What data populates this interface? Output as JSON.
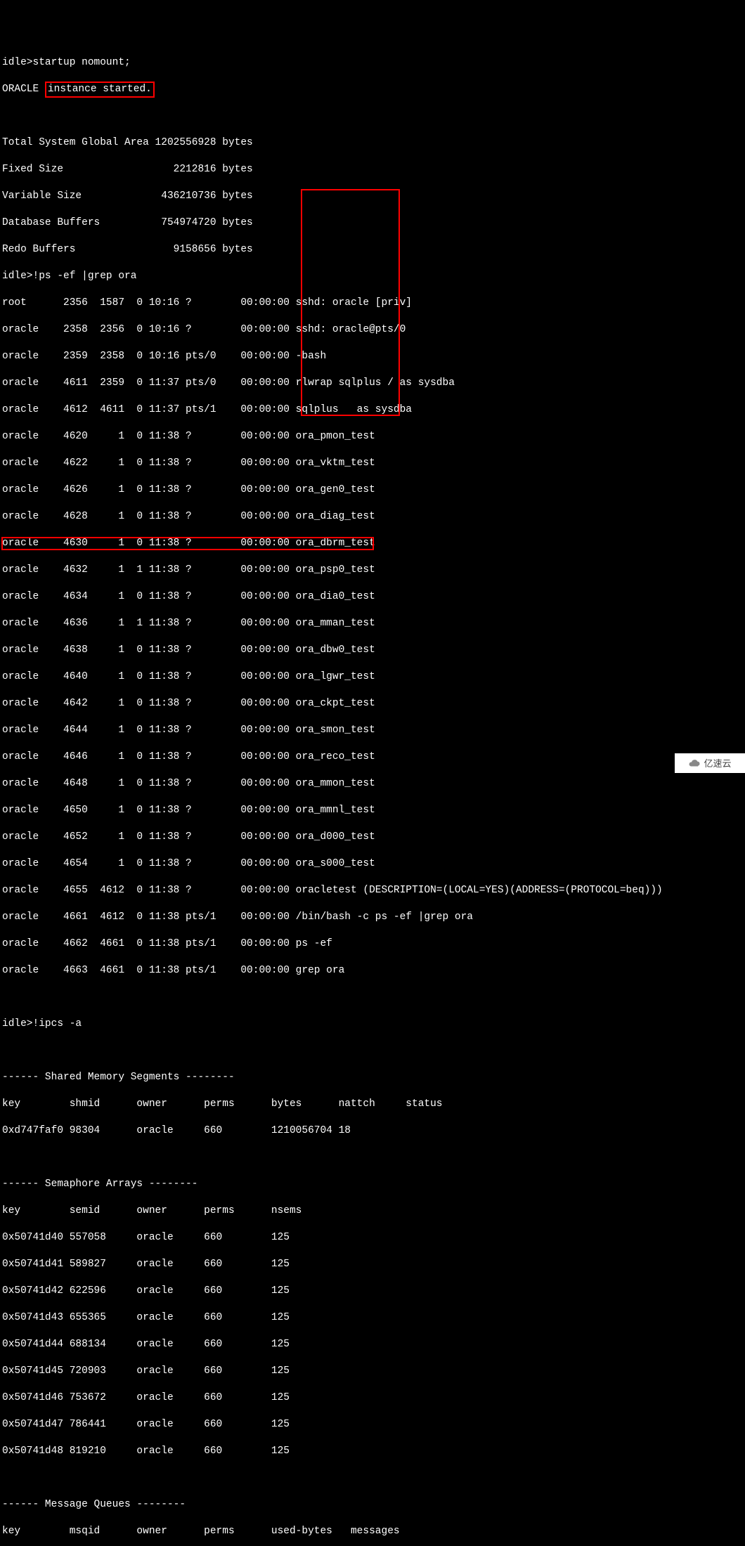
{
  "cmd1": {
    "prompt": "idle>",
    "text": "startup nomount;"
  },
  "oracle_line_prefix": "ORACLE ",
  "instance_started": "instance started.",
  "sga": {
    "total": "Total System Global Area 1202556928 bytes",
    "fixed": "Fixed Size                  2212816 bytes",
    "variable": "Variable Size             436210736 bytes",
    "dbbuf": "Database Buffers          754974720 bytes",
    "redo": "Redo Buffers                9158656 bytes"
  },
  "cmd2": {
    "prompt": "idle>",
    "text": "!ps -ef |grep ora"
  },
  "ps": [
    "root      2356  1587  0 10:16 ?        00:00:00 sshd: oracle [priv]",
    "oracle    2358  2356  0 10:16 ?        00:00:00 sshd: oracle@pts/0",
    "oracle    2359  2358  0 10:16 pts/0    00:00:00 -bash",
    "oracle    4611  2359  0 11:37 pts/0    00:00:00 rlwrap sqlplus / as sysdba",
    "oracle    4612  4611  0 11:37 pts/1    00:00:00 sqlplus   as sysdba",
    "oracle    4620     1  0 11:38 ?        00:00:00 ora_pmon_test",
    "oracle    4622     1  0 11:38 ?        00:00:00 ora_vktm_test",
    "oracle    4626     1  0 11:38 ?        00:00:00 ora_gen0_test",
    "oracle    4628     1  0 11:38 ?        00:00:00 ora_diag_test",
    "oracle    4630     1  0 11:38 ?        00:00:00 ora_dbrm_test",
    "oracle    4632     1  1 11:38 ?        00:00:00 ora_psp0_test",
    "oracle    4634     1  0 11:38 ?        00:00:00 ora_dia0_test",
    "oracle    4636     1  1 11:38 ?        00:00:00 ora_mman_test",
    "oracle    4638     1  0 11:38 ?        00:00:00 ora_dbw0_test",
    "oracle    4640     1  0 11:38 ?        00:00:00 ora_lgwr_test",
    "oracle    4642     1  0 11:38 ?        00:00:00 ora_ckpt_test",
    "oracle    4644     1  0 11:38 ?        00:00:00 ora_smon_test",
    "oracle    4646     1  0 11:38 ?        00:00:00 ora_reco_test",
    "oracle    4648     1  0 11:38 ?        00:00:00 ora_mmon_test",
    "oracle    4650     1  0 11:38 ?        00:00:00 ora_mmnl_test",
    "oracle    4652     1  0 11:38 ?        00:00:00 ora_d000_test",
    "oracle    4654     1  0 11:38 ?        00:00:00 ora_s000_test",
    "oracle    4655  4612  0 11:38 ?        00:00:00 oracletest (DESCRIPTION=(LOCAL=YES)(ADDRESS=(PROTOCOL=beq)))",
    "oracle    4661  4612  0 11:38 pts/1    00:00:00 /bin/bash -c ps -ef |grep ora",
    "oracle    4662  4661  0 11:38 pts/1    00:00:00 ps -ef",
    "oracle    4663  4661  0 11:38 pts/1    00:00:00 grep ora"
  ],
  "cmd3": {
    "prompt": "idle>",
    "text": "!ipcs -a"
  },
  "shm_header": "------ Shared Memory Segments --------",
  "shm_cols": "key        shmid      owner      perms      bytes      nattch     status",
  "shm_row": "0xd747faf0 98304      oracle     660        1210056704 18",
  "sem_header": "------ Semaphore Arrays --------",
  "sem_cols": "key        semid      owner      perms      nsems",
  "sem": [
    "0x50741d40 557058     oracle     660        125",
    "0x50741d41 589827     oracle     660        125",
    "0x50741d42 622596     oracle     660        125",
    "0x50741d43 655365     oracle     660        125",
    "0x50741d44 688134     oracle     660        125",
    "0x50741d45 720903     oracle     660        125",
    "0x50741d46 753672     oracle     660        125",
    "0x50741d47 786441     oracle     660        125",
    "0x50741d48 819210     oracle     660        125"
  ],
  "msg_header": "------ Message Queues --------",
  "msg_cols": "key        msqid      owner      perms      used-bytes   messages",
  "watermark": "亿速云"
}
